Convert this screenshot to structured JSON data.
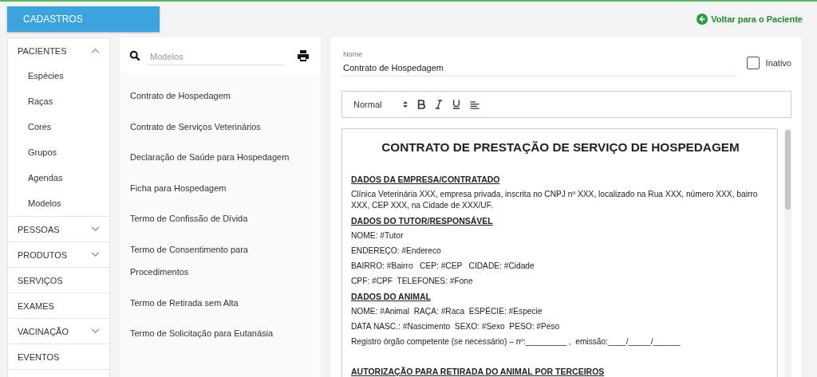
{
  "header": {
    "section_button": "CADASTROS",
    "back_link": "Voltar para o Paciente"
  },
  "sidebar": {
    "items": [
      {
        "label": "PACIENTES",
        "expanded": true,
        "children": [
          {
            "label": "Espécies"
          },
          {
            "label": "Raças"
          },
          {
            "label": "Cores"
          },
          {
            "label": "Grupos"
          },
          {
            "label": "Agendas"
          },
          {
            "label": "Modelos"
          }
        ]
      },
      {
        "label": "PESSOAS",
        "expanded": false
      },
      {
        "label": "PRODUTOS",
        "expanded": false
      },
      {
        "label": "SERVIÇOS"
      },
      {
        "label": "EXAMES"
      },
      {
        "label": "VACINAÇÃO",
        "expanded": false
      },
      {
        "label": "EVENTOS"
      }
    ]
  },
  "models": {
    "search": {
      "placeholder": "Modelos"
    },
    "items": [
      {
        "label": "Contrato de Hospedagem"
      },
      {
        "label": "Contrato de Serviços Veterinários"
      },
      {
        "label": "Declaração de Saúde para Hospedagem"
      },
      {
        "label": "Ficha para Hospedagem"
      },
      {
        "label": "Termo de Confissão de Dívida"
      },
      {
        "label": "Termo de Consentimento para Procedimentos"
      },
      {
        "label": "Termo de Retirada sem Alta"
      },
      {
        "label": "Termo de Solicitação para Eutanásia"
      }
    ]
  },
  "editor": {
    "name_label": "Nome",
    "name_value": "Contrato de Hospedagem",
    "inactive": {
      "label": "Inativo",
      "checked": false
    },
    "toolbar": {
      "format": "Normal"
    },
    "document": [
      {
        "kind": "title",
        "text": "CONTRATO DE PRESTAÇÃO DE SERVIÇO DE HOSPEDAGEM"
      },
      {
        "kind": "heading",
        "text": "DADOS DA EMPRESA/CONTRATADO"
      },
      {
        "kind": "text",
        "text": "Clínica Veterinária XXX, empresa privada, inscrita no CNPJ nº XXX, localizado na Rua XXX, número XXX, bairro XXX, CEP XXX, na Cidade de XXX/UF."
      },
      {
        "kind": "heading",
        "text": "DADOS DO TUTOR/RESPONSÁVEL"
      },
      {
        "kind": "text",
        "text": "NOME: #Tutor"
      },
      {
        "kind": "text",
        "text": "ENDEREÇO: #Endereco"
      },
      {
        "kind": "text",
        "text": "BAIRRO: #Bairro   CEP: #CEP   CIDADE: #Cidade"
      },
      {
        "kind": "text",
        "text": "CPF: #CPF  TELEFONES: #Fone"
      },
      {
        "kind": "heading",
        "text": "DADOS DO ANIMAL"
      },
      {
        "kind": "text",
        "text": "NOME: #Animal  RAÇA: #Raca  ESPÉCIE: #Especie"
      },
      {
        "kind": "text",
        "text": "DATA NASC.: #Nascimento  SEXO: #Sexo  PESO: #Peso"
      },
      {
        "kind": "text",
        "text": "Registro órgão competente (se necessário) – nº:_________ ,  emissão:____/_____/______"
      },
      {
        "kind": "gap"
      },
      {
        "kind": "heading",
        "text": "AUTORIZAÇÃO PARA RETIRADA DO ANIMAL POR TERCEIROS"
      }
    ]
  }
}
